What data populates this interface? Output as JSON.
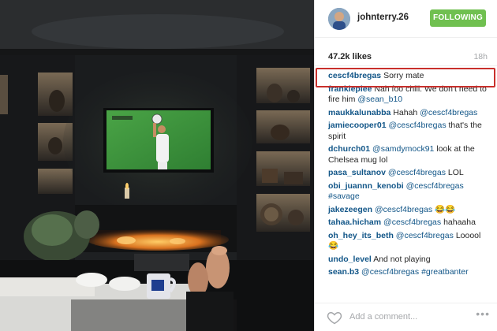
{
  "post": {
    "username": "johnterry.26",
    "follow_label": "FOLLOWING",
    "likes": "47.2k likes",
    "time": "18h"
  },
  "comments": [
    {
      "user": "cescf4bregas",
      "parts": [
        {
          "t": "Sorry mate",
          "m": false
        }
      ]
    },
    {
      "user": "frankiepiee",
      "parts": [
        {
          "t": "Nah foo chill. We don't need to fire him ",
          "m": false
        },
        {
          "t": "@sean_b10",
          "m": true
        }
      ]
    },
    {
      "user": "maukkalunabba",
      "parts": [
        {
          "t": "Hahah ",
          "m": false
        },
        {
          "t": "@cescf4bregas",
          "m": true
        }
      ]
    },
    {
      "user": "jamiecooper01",
      "parts": [
        {
          "t": "@cescf4bregas",
          "m": true
        },
        {
          "t": " that's the spirit",
          "m": false
        }
      ]
    },
    {
      "user": "dchurch01",
      "parts": [
        {
          "t": "@samdymock91",
          "m": true
        },
        {
          "t": " look at the Chelsea mug lol",
          "m": false
        }
      ]
    },
    {
      "user": "pasa_sultanov",
      "parts": [
        {
          "t": "@cescf4bregas",
          "m": true
        },
        {
          "t": " LOL",
          "m": false
        }
      ]
    },
    {
      "user": "obi_juannn_kenobi",
      "parts": [
        {
          "t": "@cescf4bregas",
          "m": true
        },
        {
          "t": " ",
          "m": false
        },
        {
          "t": "#savage",
          "m": true
        }
      ]
    },
    {
      "user": "jakezeegen",
      "parts": [
        {
          "t": "@cescf4bregas",
          "m": true
        },
        {
          "t": " 😂😂",
          "m": false
        }
      ]
    },
    {
      "user": "tahaa.hicham",
      "parts": [
        {
          "t": "@cescf4bregas",
          "m": true
        },
        {
          "t": " hahaaha",
          "m": false
        }
      ]
    },
    {
      "user": "oh_hey_its_beth",
      "parts": [
        {
          "t": "@cescf4bregas",
          "m": true
        },
        {
          "t": " Looool😂",
          "m": false
        }
      ]
    },
    {
      "user": "undo_level",
      "parts": [
        {
          "t": "And not playing",
          "m": false
        }
      ]
    },
    {
      "user": "sean.b3",
      "parts": [
        {
          "t": "@cescf4bregas",
          "m": true
        },
        {
          "t": " ",
          "m": false
        },
        {
          "t": "#greatbanter",
          "m": true
        }
      ]
    }
  ],
  "footer": {
    "add_comment_placeholder": "Add a comment...",
    "more_glyph": "•••"
  },
  "colors": {
    "follow_green": "#70c050",
    "link_blue": "#125688",
    "highlight_red": "#c9302c"
  },
  "icons": [
    "heart-icon",
    "more-options-icon",
    "avatar"
  ]
}
